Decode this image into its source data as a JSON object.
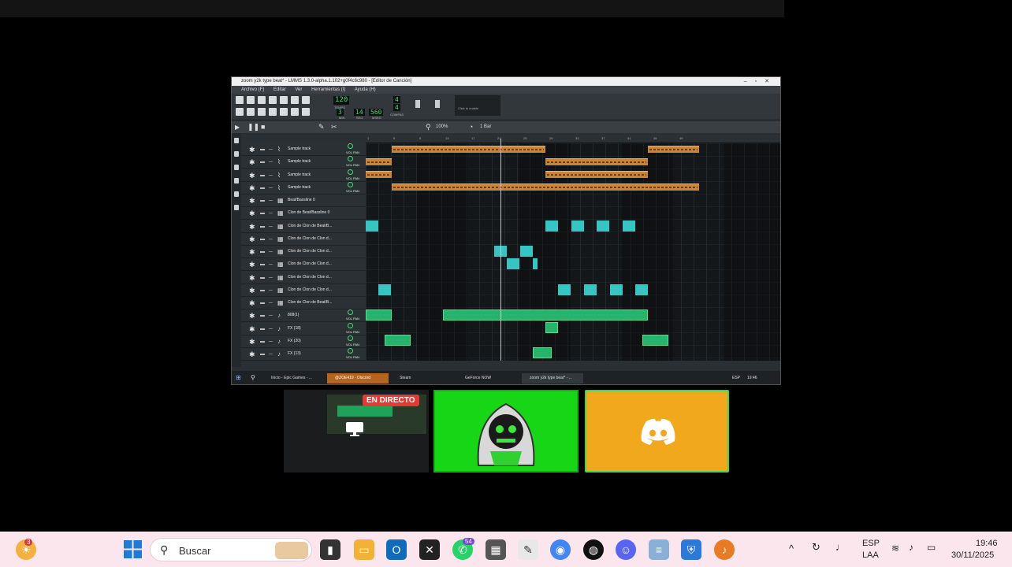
{
  "lmms": {
    "title": "zoom y2k type beat* - LMMS 1.3.0-alpha.1.102+g0f4c6c980 - [Editor de Canción]",
    "menu": [
      "Archivo (F)",
      "Editar",
      "Ver",
      "Herramientas (I)",
      "Ayuda (H)"
    ],
    "tempo_value": "120",
    "tempo_label": "TEMPO",
    "time_min": "3",
    "time_sec": "14",
    "time_msec": "560",
    "time_labels": [
      "MIN",
      "SEG",
      "MSEG"
    ],
    "compas_top": "4",
    "compas_bottom": "4",
    "compas_label": "COMPAS",
    "click_enable": "Click to enable",
    "zoom_value": "100%",
    "quantize_value": "1 Bar",
    "timeline_marks": [
      "1",
      "5",
      "9",
      "13",
      "17",
      "21",
      "25",
      "29",
      "33",
      "37",
      "41",
      "45",
      "49"
    ],
    "tracks": [
      {
        "name": "Sample track",
        "icon": "sample-icon"
      },
      {
        "name": "Sample track",
        "icon": "sample-icon"
      },
      {
        "name": "Sample track",
        "icon": "sample-icon"
      },
      {
        "name": "Sample track",
        "icon": "sample-icon"
      },
      {
        "name": "Beat/Bassline 0",
        "icon": "beat-icon"
      },
      {
        "name": "Clon de Beat/Bassline 0",
        "icon": "beat-icon"
      },
      {
        "name": "Clon de Clon de Beat/B...",
        "icon": "beat-icon"
      },
      {
        "name": "Clon de Clon de Clon d...",
        "icon": "beat-icon"
      },
      {
        "name": "Clon de Clon de Clon d...",
        "icon": "beat-icon"
      },
      {
        "name": "Clon de Clon de Clon d...",
        "icon": "beat-icon"
      },
      {
        "name": "Clon de Clon de Clon d...",
        "icon": "beat-icon"
      },
      {
        "name": "Clon de Clon de Clon d...",
        "icon": "beat-icon"
      },
      {
        "name": "Clon de Clon de Beat/B...",
        "icon": "beat-icon"
      },
      {
        "name": "808(1)",
        "icon": "note-icon"
      },
      {
        "name": "FX (18)",
        "icon": "note-icon"
      },
      {
        "name": "FX (20)",
        "icon": "note-icon"
      },
      {
        "name": "FX (13)",
        "icon": "note-icon"
      }
    ],
    "vol_pan": "VOL PAN",
    "clip_label": "zoom_sample",
    "taskbar_items": [
      {
        "label": "Inicio - Epic Games - ...",
        "icon": "epic-icon"
      },
      {
        "label": "@ZOE419 - Discord",
        "icon": "discord-icon"
      },
      {
        "label": "Steam",
        "icon": "steam-icon"
      },
      {
        "label": "GeForce NOW",
        "icon": "geforce-icon"
      },
      {
        "label": "zoom y2k type beat* - ...",
        "icon": "lmms-icon"
      }
    ],
    "tray_lang": "ESP",
    "tray_time": "19:46"
  },
  "stream": {
    "live_badge": "EN DIRECTO"
  },
  "taskbar": {
    "search_placeholder": "Buscar",
    "weather_badge": "3",
    "whatsapp_badge": "54",
    "lang_top": "ESP",
    "lang_bottom": "LAA",
    "time": "19:46",
    "date": "30/11/2025"
  }
}
